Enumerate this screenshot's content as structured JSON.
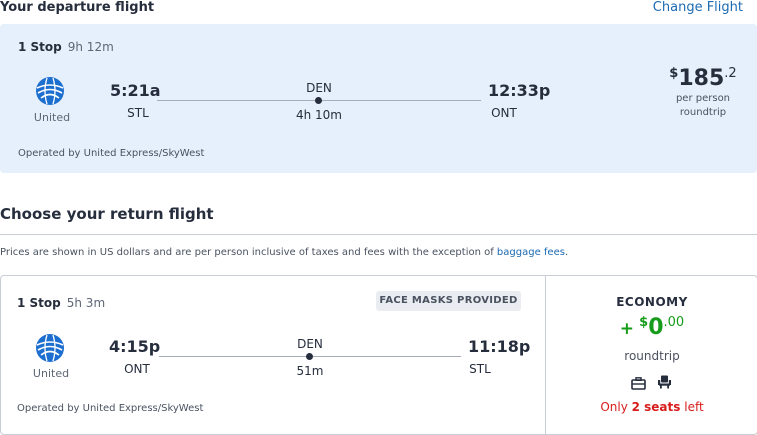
{
  "departure": {
    "heading": "Your departure flight",
    "change_link": "Change Flight",
    "stops": "1 Stop",
    "total_duration": "9h 12m",
    "airline": "United",
    "depart_time": "5:21a",
    "depart_code": "STL",
    "via": "DEN",
    "leg_duration": "4h 10m",
    "arrive_time": "12:33p",
    "arrive_code": "ONT",
    "price_currency": "$",
    "price_amount": "185",
    "price_cents": ".2",
    "price_sub1": "per person",
    "price_sub2": "roundtrip",
    "operated_by": "Operated by United Express/SkyWest"
  },
  "return_section": {
    "heading": "Choose your return flight",
    "note_text": "Prices are shown in US dollars and are per person inclusive of taxes and fees with the exception of ",
    "note_link": "baggage fees",
    "note_end": "."
  },
  "return_flight": {
    "stops": "1 Stop",
    "total_duration": "5h 3m",
    "badge": "FACE MASKS PROVIDED",
    "airline": "United",
    "depart_time": "4:15p",
    "depart_code": "ONT",
    "via": "DEN",
    "leg_duration": "51m",
    "arrive_time": "11:18p",
    "arrive_code": "STL",
    "operated_by": "Operated by United Express/SkyWest",
    "cabin": "ECONOMY",
    "price_plus": "+",
    "price_currency": "$",
    "price_amount": "0",
    "price_cents": ".00",
    "price_sub": "roundtrip",
    "amenity_icons": [
      "carry-on-bag-icon",
      "seat-icon"
    ],
    "seats_prefix": "Only ",
    "seats_count": "2 seats",
    "seats_suffix": " left"
  },
  "colors": {
    "link": "#1c6ab3",
    "card_bg": "#e5f0fc",
    "price_green": "#169c1a",
    "warning_red": "#d91c1c",
    "united_blue": "#1d6fcf"
  }
}
